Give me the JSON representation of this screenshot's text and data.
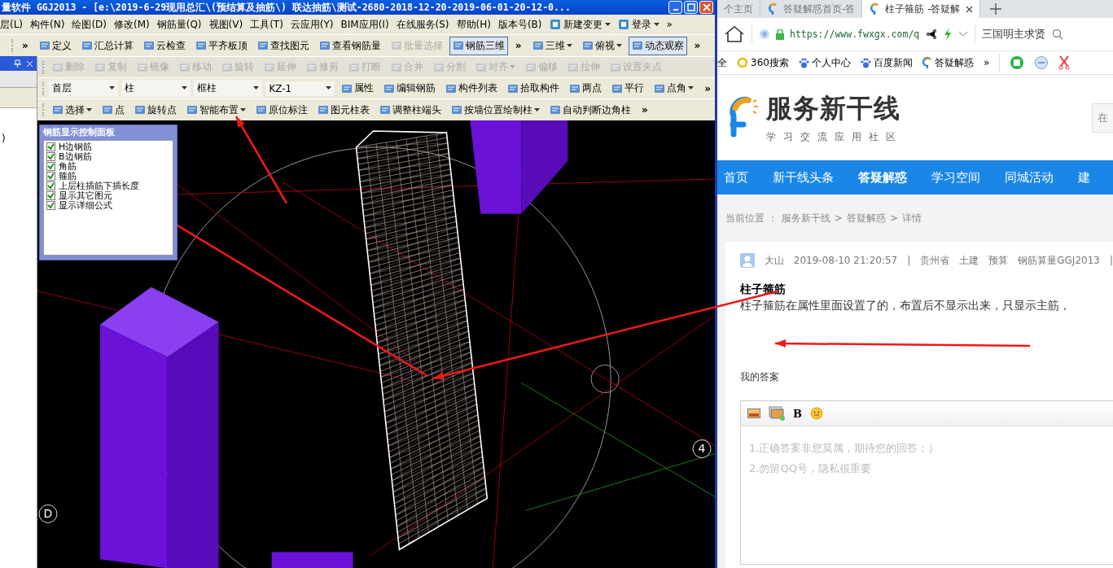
{
  "app": {
    "title": "量软件 GGJ2013 - [e:\\2019-6-29现用总汇\\(预结算及抽筋\\) 联达抽筋\\测试-2680-2018-12-20-2019-06-01-20-12-0...",
    "menu": [
      {
        "label": "层(L)"
      },
      {
        "label": "构件(N)"
      },
      {
        "label": "绘图(D)"
      },
      {
        "label": "修改(M)"
      },
      {
        "label": "钢筋量(Q)"
      },
      {
        "label": "视图(V)"
      },
      {
        "label": "工具(T)"
      },
      {
        "label": "云应用(Y)"
      },
      {
        "label": "BIM应用(I)"
      },
      {
        "label": "在线服务(S)"
      },
      {
        "label": "帮助(H)"
      },
      {
        "label": "版本号(B)"
      },
      {
        "label": "新建变更",
        "icon": true,
        "dropdown": true
      },
      {
        "label": "登录",
        "icon": true,
        "dropdown": true
      },
      {
        "label": "»"
      }
    ],
    "toolbars": [
      {
        "items": [
          {
            "kind": "chevron",
            "label": "»"
          },
          {
            "kind": "button",
            "label": "定义",
            "icon": true
          },
          {
            "kind": "button",
            "label": "汇总计算",
            "icon": true
          },
          {
            "kind": "button",
            "label": "云检查",
            "icon": true
          },
          {
            "kind": "button",
            "label": "平齐板顶",
            "icon": true
          },
          {
            "kind": "button",
            "label": "查找图元",
            "icon": true
          },
          {
            "kind": "button",
            "label": "查看钢筋量",
            "icon": true
          },
          {
            "kind": "button",
            "label": "批量选择",
            "icon": true,
            "disabled": true
          },
          {
            "kind": "button",
            "label": "钢筋三维",
            "icon": true,
            "pressed": true
          },
          {
            "kind": "chevron",
            "label": "»"
          },
          {
            "kind": "button",
            "label": "三维",
            "icon": true,
            "dropdown": true
          },
          {
            "kind": "button",
            "label": "俯视",
            "icon": true,
            "dropdown": true
          },
          {
            "kind": "button",
            "label": "动态观察",
            "icon": true,
            "pressed": true
          },
          {
            "kind": "chevron",
            "label": "»"
          }
        ]
      },
      {
        "items": [
          {
            "kind": "button",
            "label": "删除",
            "icon": true,
            "disabled": true
          },
          {
            "kind": "button",
            "label": "复制",
            "icon": true,
            "disabled": true
          },
          {
            "kind": "button",
            "label": "镜像",
            "icon": true,
            "disabled": true
          },
          {
            "kind": "button",
            "label": "移动",
            "icon": true,
            "disabled": true
          },
          {
            "kind": "button",
            "label": "旋转",
            "icon": true,
            "disabled": true
          },
          {
            "kind": "button",
            "label": "延伸",
            "icon": true,
            "disabled": true
          },
          {
            "kind": "button",
            "label": "修剪",
            "icon": true,
            "disabled": true
          },
          {
            "kind": "button",
            "label": "打断",
            "icon": true,
            "disabled": true
          },
          {
            "kind": "button",
            "label": "合并",
            "icon": true,
            "disabled": true
          },
          {
            "kind": "button",
            "label": "分割",
            "icon": true,
            "disabled": true
          },
          {
            "kind": "button",
            "label": "对齐",
            "icon": true,
            "disabled": true,
            "dropdown": true
          },
          {
            "kind": "button",
            "label": "偏移",
            "icon": true,
            "disabled": true
          },
          {
            "kind": "button",
            "label": "拉伸",
            "icon": true,
            "disabled": true
          },
          {
            "kind": "button",
            "label": "设置夹点",
            "icon": true,
            "disabled": true
          }
        ]
      },
      {
        "items": [
          {
            "kind": "select",
            "label": "首层"
          },
          {
            "kind": "select",
            "label": "柱"
          },
          {
            "kind": "select",
            "label": "框柱"
          },
          {
            "kind": "select",
            "label": "KZ-1"
          },
          {
            "kind": "button",
            "label": "属性",
            "icon": true
          },
          {
            "kind": "button",
            "label": "编辑钢筋",
            "icon": true
          },
          {
            "kind": "button",
            "label": "构件列表",
            "icon": true
          },
          {
            "kind": "button",
            "label": "拾取构件",
            "icon": true
          },
          {
            "kind": "button",
            "label": "两点",
            "icon": true
          },
          {
            "kind": "button",
            "label": "平行",
            "icon": true
          },
          {
            "kind": "button",
            "label": "点角",
            "icon": true,
            "dropdown": true
          },
          {
            "kind": "chevron",
            "label": "»"
          }
        ]
      },
      {
        "items": [
          {
            "kind": "button",
            "label": "选择",
            "icon": true,
            "dropdown": true
          },
          {
            "kind": "button",
            "label": "点",
            "icon": true
          },
          {
            "kind": "button",
            "label": "旋转点",
            "icon": true
          },
          {
            "kind": "button",
            "label": "智能布置",
            "icon": true,
            "dropdown": true
          },
          {
            "kind": "button",
            "label": "原位标注",
            "icon": true
          },
          {
            "kind": "button",
            "label": "图元柱表",
            "icon": true
          },
          {
            "kind": "button",
            "label": "调整柱端头",
            "icon": true
          },
          {
            "kind": "button",
            "label": "按墙位置绘制柱",
            "icon": true,
            "dropdown": true
          },
          {
            "kind": "button",
            "label": "自动判断边角柱",
            "icon": true
          },
          {
            "kind": "chevron",
            "label": "»"
          }
        ]
      }
    ],
    "dock": {
      "fragment": ")"
    },
    "panel": {
      "title": "钢筋显示控制面板",
      "items": [
        {
          "label": "H边钢筋",
          "checked": true
        },
        {
          "label": "B边钢筋",
          "checked": true
        },
        {
          "label": "角筋",
          "checked": true
        },
        {
          "label": "箍筋",
          "checked": true
        },
        {
          "label": "上层柱插筋下插长度",
          "checked": true
        },
        {
          "label": "显示其它图元",
          "checked": true
        },
        {
          "label": "显示详细公式",
          "checked": true
        }
      ]
    },
    "axis_labels": [
      "4",
      "D"
    ]
  },
  "browser": {
    "tabs": [
      {
        "title": "个主页",
        "selected": false,
        "icon": false
      },
      {
        "title": "答疑解惑首页-答",
        "selected": false,
        "icon": true
      },
      {
        "title": "柱子箍筋 -答疑解",
        "selected": true,
        "icon": true
      }
    ],
    "url": "https://www.fwxgx.com/q",
    "search": "三国明主求贤",
    "bookmarks": [
      {
        "label": "全"
      },
      {
        "label": "360搜索"
      },
      {
        "label": "个人中心"
      },
      {
        "label": "百度新闻"
      },
      {
        "label": "答疑解惑"
      },
      {
        "label": "»"
      }
    ],
    "site": {
      "name": "服务新干线",
      "tagline": "学习交流应用社区",
      "search_fragment": "在",
      "nav": [
        {
          "label": "首页",
          "selected": false
        },
        {
          "label": "新干线头条",
          "selected": false
        },
        {
          "label": "答疑解惑",
          "selected": true
        },
        {
          "label": "学习空间",
          "selected": false
        },
        {
          "label": "同城活动",
          "selected": false
        },
        {
          "label": "建",
          "selected": false
        }
      ],
      "breadcrumb": [
        "当前位置 ：",
        "服务新干线",
        ">",
        "答疑解惑",
        ">",
        "详情"
      ],
      "meta_dividers": [
        "|",
        "|"
      ],
      "author": "大山",
      "time": "2019-08-10 21:20:57",
      "tags": [
        "贵州省",
        "土建",
        "预算",
        "钢筋算量GGJ2013"
      ],
      "question_title": "柱子箍筋",
      "question_body": "柱子箍筋在属性里面设置了的，布置后不显示出来，只显示主筋，",
      "answer_label": "我的答案",
      "editor_tools": [
        "B"
      ],
      "answer_placeholder": [
        "1.正确答案非您莫属，期待您的回答：）",
        "2.勿留QQ号，隐私很重要"
      ]
    }
  }
}
